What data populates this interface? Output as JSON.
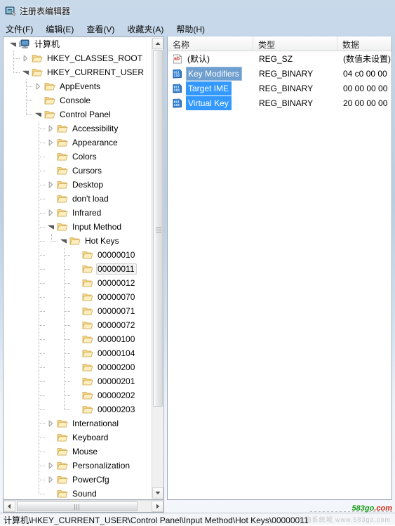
{
  "window": {
    "title": "注册表编辑器",
    "icon": "registry-editor-icon"
  },
  "menubar": {
    "items": [
      {
        "label": "文件(F)",
        "name": "menu-file"
      },
      {
        "label": "编辑(E)",
        "name": "menu-edit"
      },
      {
        "label": "查看(V)",
        "name": "menu-view"
      },
      {
        "label": "收藏夹(A)",
        "name": "menu-favorites"
      },
      {
        "label": "帮助(H)",
        "name": "menu-help"
      }
    ]
  },
  "tree": {
    "root": {
      "label": "计算机",
      "icon": "computer-icon",
      "state": "expanded"
    },
    "nodes": [
      {
        "label": "HKEY_CLASSES_ROOT",
        "depth": 1,
        "state": "collapsed",
        "selected": false
      },
      {
        "label": "HKEY_CURRENT_USER",
        "depth": 1,
        "state": "expanded",
        "selected": false
      },
      {
        "label": "AppEvents",
        "depth": 2,
        "state": "collapsed",
        "selected": false
      },
      {
        "label": "Console",
        "depth": 2,
        "state": "leaf",
        "selected": false
      },
      {
        "label": "Control Panel",
        "depth": 2,
        "state": "expanded",
        "selected": false
      },
      {
        "label": "Accessibility",
        "depth": 3,
        "state": "collapsed",
        "selected": false
      },
      {
        "label": "Appearance",
        "depth": 3,
        "state": "collapsed",
        "selected": false
      },
      {
        "label": "Colors",
        "depth": 3,
        "state": "leaf",
        "selected": false
      },
      {
        "label": "Cursors",
        "depth": 3,
        "state": "leaf",
        "selected": false
      },
      {
        "label": "Desktop",
        "depth": 3,
        "state": "collapsed",
        "selected": false
      },
      {
        "label": "don't load",
        "depth": 3,
        "state": "leaf",
        "selected": false
      },
      {
        "label": "Infrared",
        "depth": 3,
        "state": "collapsed",
        "selected": false
      },
      {
        "label": "Input Method",
        "depth": 3,
        "state": "expanded",
        "selected": false
      },
      {
        "label": "Hot Keys",
        "depth": 4,
        "state": "expanded",
        "selected": false
      },
      {
        "label": "00000010",
        "depth": 5,
        "state": "leaf",
        "selected": false
      },
      {
        "label": "00000011",
        "depth": 5,
        "state": "leaf",
        "selected": true
      },
      {
        "label": "00000012",
        "depth": 5,
        "state": "leaf",
        "selected": false
      },
      {
        "label": "00000070",
        "depth": 5,
        "state": "leaf",
        "selected": false
      },
      {
        "label": "00000071",
        "depth": 5,
        "state": "leaf",
        "selected": false
      },
      {
        "label": "00000072",
        "depth": 5,
        "state": "leaf",
        "selected": false
      },
      {
        "label": "00000100",
        "depth": 5,
        "state": "leaf",
        "selected": false
      },
      {
        "label": "00000104",
        "depth": 5,
        "state": "leaf",
        "selected": false
      },
      {
        "label": "00000200",
        "depth": 5,
        "state": "leaf",
        "selected": false
      },
      {
        "label": "00000201",
        "depth": 5,
        "state": "leaf",
        "selected": false
      },
      {
        "label": "00000202",
        "depth": 5,
        "state": "leaf",
        "selected": false
      },
      {
        "label": "00000203",
        "depth": 5,
        "state": "leaf",
        "selected": false
      },
      {
        "label": "International",
        "depth": 3,
        "state": "collapsed",
        "selected": false
      },
      {
        "label": "Keyboard",
        "depth": 3,
        "state": "leaf",
        "selected": false
      },
      {
        "label": "Mouse",
        "depth": 3,
        "state": "leaf",
        "selected": false
      },
      {
        "label": "Personalization",
        "depth": 3,
        "state": "collapsed",
        "selected": false
      },
      {
        "label": "PowerCfg",
        "depth": 3,
        "state": "collapsed",
        "selected": false
      },
      {
        "label": "Sound",
        "depth": 3,
        "state": "leaf",
        "selected": false
      }
    ]
  },
  "list": {
    "columns": [
      {
        "label": "名称",
        "name": "column-name"
      },
      {
        "label": "类型",
        "name": "column-type"
      },
      {
        "label": "数据",
        "name": "column-data"
      }
    ],
    "rows": [
      {
        "name": "(默认)",
        "type": "REG_SZ",
        "data": "(数值未设置)",
        "icon": "string-value-icon",
        "selected": false,
        "focused": false
      },
      {
        "name": "Key Modifiers",
        "type": "REG_BINARY",
        "data": "04 c0 00 00",
        "icon": "binary-value-icon",
        "selected": true,
        "focused": true
      },
      {
        "name": "Target IME",
        "type": "REG_BINARY",
        "data": "00 00 00 00",
        "icon": "binary-value-icon",
        "selected": true,
        "focused": false
      },
      {
        "name": "Virtual Key",
        "type": "REG_BINARY",
        "data": "20 00 00 00",
        "icon": "binary-value-icon",
        "selected": true,
        "focused": false
      }
    ]
  },
  "statusbar": {
    "path": "计算机\\HKEY_CURRENT_USER\\Control Panel\\Input Method\\Hot Keys\\00000011"
  },
  "watermark": {
    "site": "583go",
    "tld": ".com",
    "ghost": "电脑系统城 www.583go.com"
  },
  "colors": {
    "selection_blue": "#3399ff",
    "focused_selection": "#6f9fcf",
    "titlebar_top": "#c8d9ea",
    "folder_yellow": "#f8d97a",
    "watermark_green": "#169c16",
    "watermark_red": "#d42a16"
  }
}
